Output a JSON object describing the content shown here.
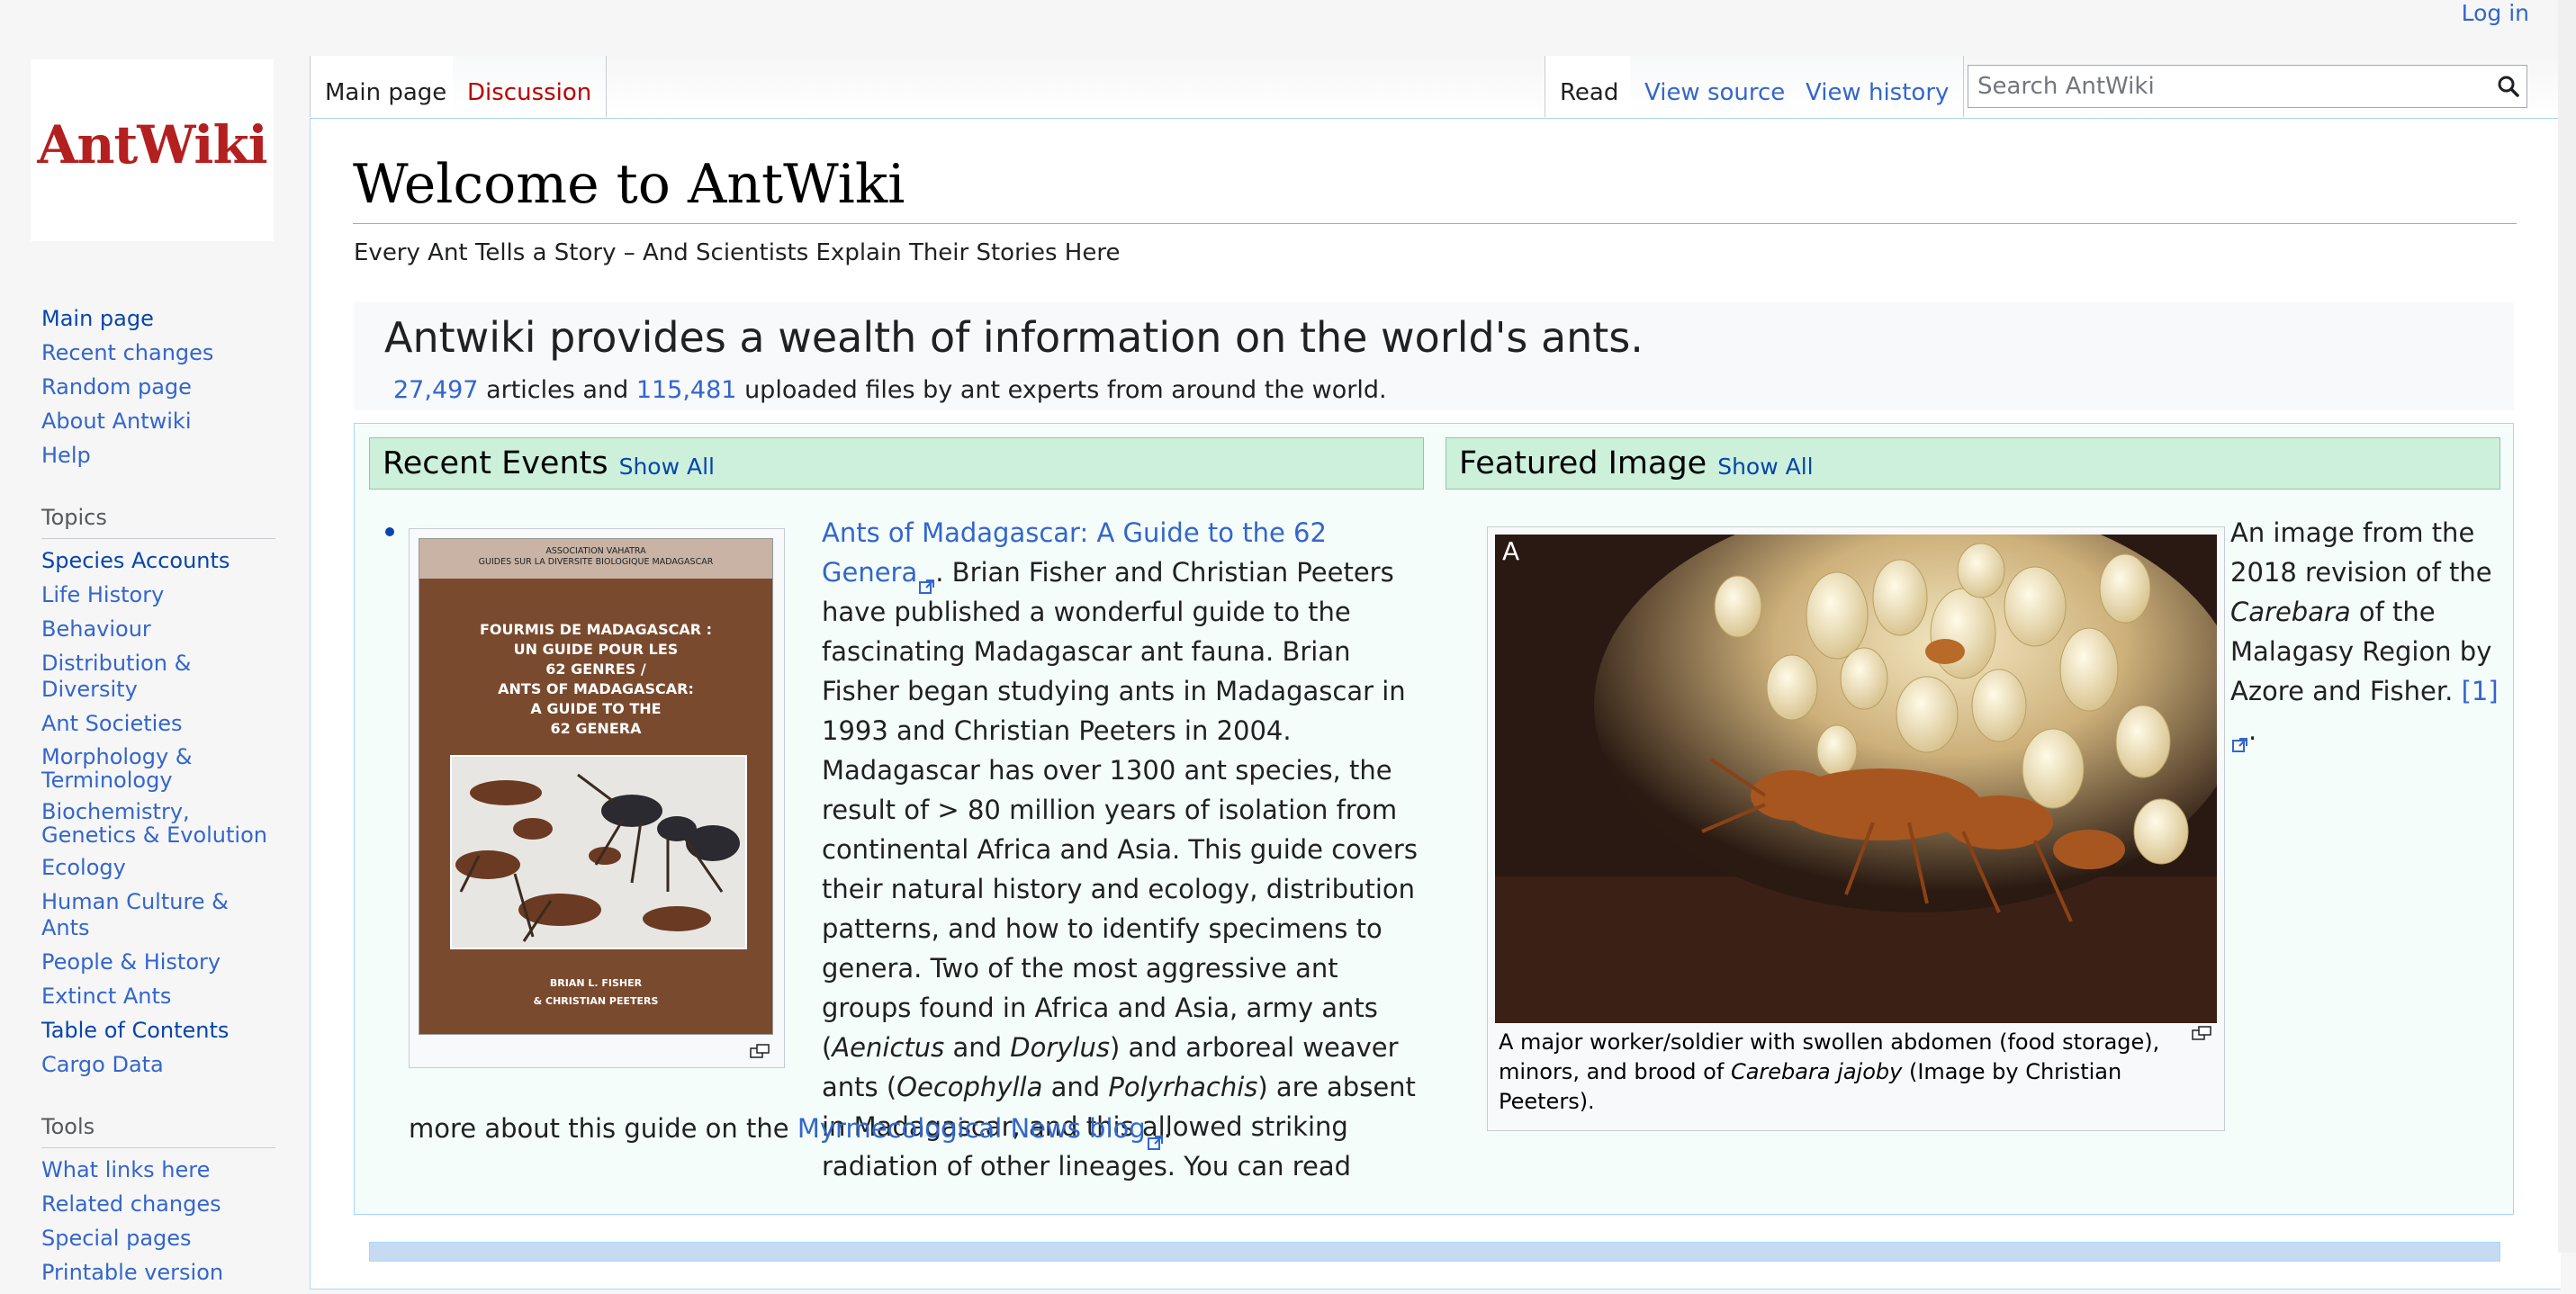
{
  "personal": {
    "login": "Log in"
  },
  "logo": {
    "text": "AntWiki"
  },
  "tabs": {
    "main_page": "Main page",
    "discussion": "Discussion",
    "read": "Read",
    "view_source": "View source",
    "view_history": "View history"
  },
  "search": {
    "placeholder": "Search AntWiki",
    "icon": "search-icon"
  },
  "sidebar": {
    "nav": [
      "Main page",
      "Recent changes",
      "Random page",
      "About Antwiki",
      "Help"
    ],
    "topics_heading": "Topics",
    "topics": [
      "Species Accounts",
      "Life History",
      "Behaviour",
      "Distribution & Diversity",
      "Ant Societies",
      "Morphology & Terminology",
      "Biochemistry, Genetics & Evolution",
      "Ecology",
      "Human Culture & Ants",
      "People & History",
      "Extinct Ants",
      "Table of Contents",
      "Cargo Data"
    ],
    "tools_heading": "Tools",
    "tools": [
      "What links here",
      "Related changes",
      "Special pages",
      "Printable version"
    ]
  },
  "page": {
    "title": "Welcome to AntWiki",
    "tagline": "Every Ant Tells a Story – And Scientists Explain Their Stories Here"
  },
  "banner": {
    "headline": "Antwiki provides a wealth of information on the world's ants.",
    "articles_count": "27,497",
    "articles_text": "articles and",
    "files_count": "115,481",
    "files_text": "uploaded files by ant experts from around the world."
  },
  "recent_events": {
    "heading": "Recent Events",
    "show_all": "Show All",
    "book": {
      "band": "ASSOCIATION VAHATRA\nGUIDES SUR LA DIVERSITE BIOLOGIQUE MADAGASCAR",
      "title": "FOURMIS DE MADAGASCAR :\nUN GUIDE POUR LES\n62 GENRES /\nANTS OF MADAGASCAR:\nA GUIDE TO THE\n62 GENERA",
      "authors": "BRIAN L. FISHER\n& CHRISTIAN PEETERS"
    },
    "link": "Ants of Madagascar: A Guide to the 62 Genera",
    "text1": "Brian Fisher and Christian Peeters have published a wonderful guide to the fascinating Madagascar ant fauna. Brian Fisher began studying ants in Madagascar in 1993 and Christian Peeters in 2004. Madagascar has over 1300 ant species, the result of > 80 million years of isolation from continental Africa and Asia. This guide covers their natural history and ecology, distribution patterns, and how to identify specimens to genera. Two of the most aggressive ant groups found in Africa and Asia, army ants (",
    "genus1": "Aenictus",
    "and1": "and",
    "genus2": "Dorylus",
    "text2": ") and arboreal weaver ants (",
    "genus3": "Oecophylla",
    "and2": "and",
    "genus4": "Polyrhachis",
    "text3": ") are absent in Madagascar, and this allowed striking radiation of other lineages. You can read",
    "last_prefix": "more about this guide on the",
    "blog_link": "Myrmecological News blog"
  },
  "featured_image": {
    "heading": "Featured Image",
    "show_all": "Show All",
    "label": "A",
    "caption_pre": "A major worker/soldier with swollen abdomen (food storage), minors, and brood of",
    "caption_species": "Carebara jajoby",
    "caption_post": "(Image by Christian Peeters).",
    "side_pre": "An image from the 2018 revision of the",
    "side_genus": "Carebara",
    "side_post": "of the Malagasy Region by Azore and Fisher.",
    "side_ref": "[1]"
  }
}
